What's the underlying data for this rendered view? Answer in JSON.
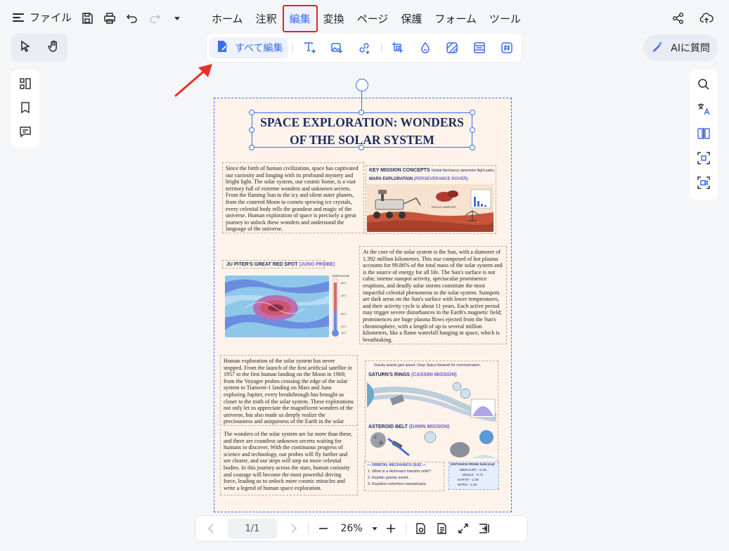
{
  "menubar": {
    "file_label": "ファイル",
    "tabs": [
      "ホーム",
      "注釈",
      "編集",
      "変換",
      "ページ",
      "保護",
      "フォーム",
      "ツール"
    ],
    "active_tab": "編集"
  },
  "edit_toolbar": {
    "edit_all_label": "すべて編集"
  },
  "ai_button": {
    "label": "AIに質問"
  },
  "document": {
    "title_line1": "SPACE EXPLORATION: WONDERS",
    "title_line2": "OF THE SOLAR SYSTEM",
    "para1": "Since the birth of human civilization, space has captivated our curiosity and longing with its profound mystery and bright light. The solar system, our cosmic home, is a vast territory full of extreme wonders and unknown secrets. From the flaming Sun to the icy and silent outer planets, from the cratered Moon to comets spewing ice crystals, every celestial body tells the grandeur and magic of the universe. Human exploration of space is precisely a great journey to unlock these wonders and understand the language of the universe.",
    "para2": "At the core of the solar system is the Sun, with a diameter of 1.392 million kilometers. This star composed of hot plasma accounts for 99.86% of the total mass of the solar system and is the source of energy for all life. The Sun's surface is not calm; intense sunspot activity, spectacular prominence eruptions, and deadly solar storms constitute the most impactful celestial phenomena in the solar system. Sunspots are dark areas on the Sun's surface with lower temperatures, and their activity cycle is about 11 years. Each active period may trigger severe disturbances in the Earth's magnetic field; prominences are huge plasma flows ejected from the Sun's chromosphere, with a length of up to several million kilometers, like a flame waterfall hanging in space, which is breathtaking.",
    "para3": "Human exploration of the solar system has never stopped. From the launch of the first artificial satellite in 1957 to the first human landing on the Moon in 1969; from the Voyager probes crossing the edge of the solar system to Tianwen-1 landing on Mars and Juno exploring Jupiter, every breakthrough has brought us closer to the truth of the solar system. These explorations not only let us appreciate the magnificent wonders of the universe, but also made us deeply realize the preciousness and uniqueness of the Earth in the solar system.",
    "para4": "The wonders of the solar system are far more than these, and there are countless unknown secrets waiting for humans to discover. With the continuous progress of science and technology, our probes will fly farther and see clearer, and our steps will step on more celestial bodies. In this journey across the stars, human curiosity and courage will become the most powerful driving force, leading us to unlock more cosmic miracles and write a legend of human space exploration.",
    "cap_key": "KEY MISSION CONCEPTS",
    "cap_key_sub": "Orbital Mechanics determine flight paths.",
    "cap_mars": "MARS EXPLORATION",
    "cap_mars_em": "(PERSEVERANCE ROVER)",
    "cap_jupiter": "JU PITER'S GREAT RED SPOT",
    "cap_jupiter_em": "(JUNO PROBE)",
    "cap_gravity": "Gravity assists gain speed. Deep Space Network for communication.",
    "cap_saturn": "SATURN'S RINGS",
    "cap_saturn_em": "(CASSINI MISSION)",
    "cap_asteroid": "ASTEROID BELT",
    "cap_asteroid_em": "(DAWN MISSION)",
    "quiz_title": "— ORBITAL MECHANICS QUIZ —",
    "quiz_q1": "1. What is a Hohmann transfer orbit?",
    "quiz_q2": "2. Explain gravity assist.",
    "quiz_q3": "3. Explains nohemics wavephasia.",
    "dist_title": "DISTANCE FROM SUN (AU)",
    "dist_rows": [
      "MERCURY - 0.39",
      "VENUS - 0.72",
      "EARTH    - 1.00",
      "MARS     - 1.52"
    ],
    "temp_label": "TEMPERATURE",
    "temp_ticks": [
      "-60°C",
      "-40°C",
      "-50°C",
      "-20°C",
      "-10°C"
    ]
  },
  "bottom_bar": {
    "page_value": "1/1",
    "zoom_value": "26%"
  },
  "colors": {
    "accent": "#3b6df0",
    "highlight_border": "#e2251f",
    "arrow": "#e8302a"
  }
}
